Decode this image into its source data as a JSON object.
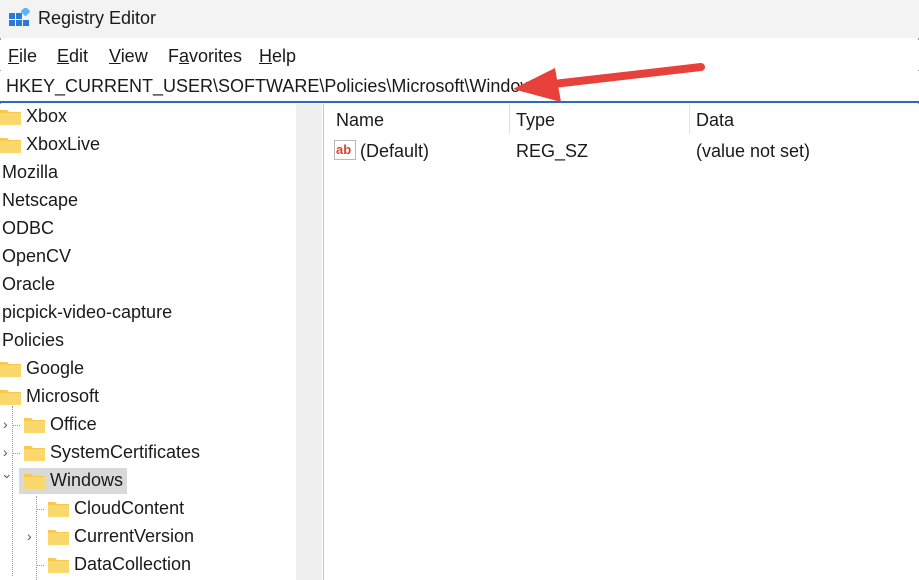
{
  "window": {
    "title": "Registry Editor"
  },
  "menu": [
    {
      "key": "F",
      "rest": "ile"
    },
    {
      "key": "E",
      "rest": "dit"
    },
    {
      "key": "V",
      "rest": "iew"
    },
    {
      "key": "F",
      "rest": "a",
      "after": "vorites"
    },
    {
      "key": "H",
      "rest": "elp"
    }
  ],
  "address": {
    "path": "HKEY_CURRENT_USER\\SOFTWARE\\Policies\\Microsoft\\Windows"
  },
  "tree": [
    {
      "label": "Xbox"
    },
    {
      "label": "XboxLive"
    },
    {
      "label": "Mozilla"
    },
    {
      "label": "Netscape"
    },
    {
      "label": "ODBC"
    },
    {
      "label": "OpenCV"
    },
    {
      "label": "Oracle"
    },
    {
      "label": "picpick-video-capture"
    },
    {
      "label": "Policies"
    },
    {
      "label": "Google"
    },
    {
      "label": "Microsoft"
    },
    {
      "label": "Office"
    },
    {
      "label": "SystemCertificates"
    },
    {
      "label": "Windows"
    },
    {
      "label": "CloudContent"
    },
    {
      "label": "CurrentVersion"
    },
    {
      "label": "DataCollection"
    }
  ],
  "list": {
    "columns": [
      "Name",
      "Type",
      "Data"
    ],
    "rows": [
      {
        "name": "(Default)",
        "type": "REG_SZ",
        "data": "(value not set)",
        "icon": "string-value-icon"
      }
    ]
  },
  "colors": {
    "address_underline": "#2a6cb8",
    "arrow": "#e8403b",
    "folder": "#f8c94a",
    "selection": "#d9d9d9"
  }
}
